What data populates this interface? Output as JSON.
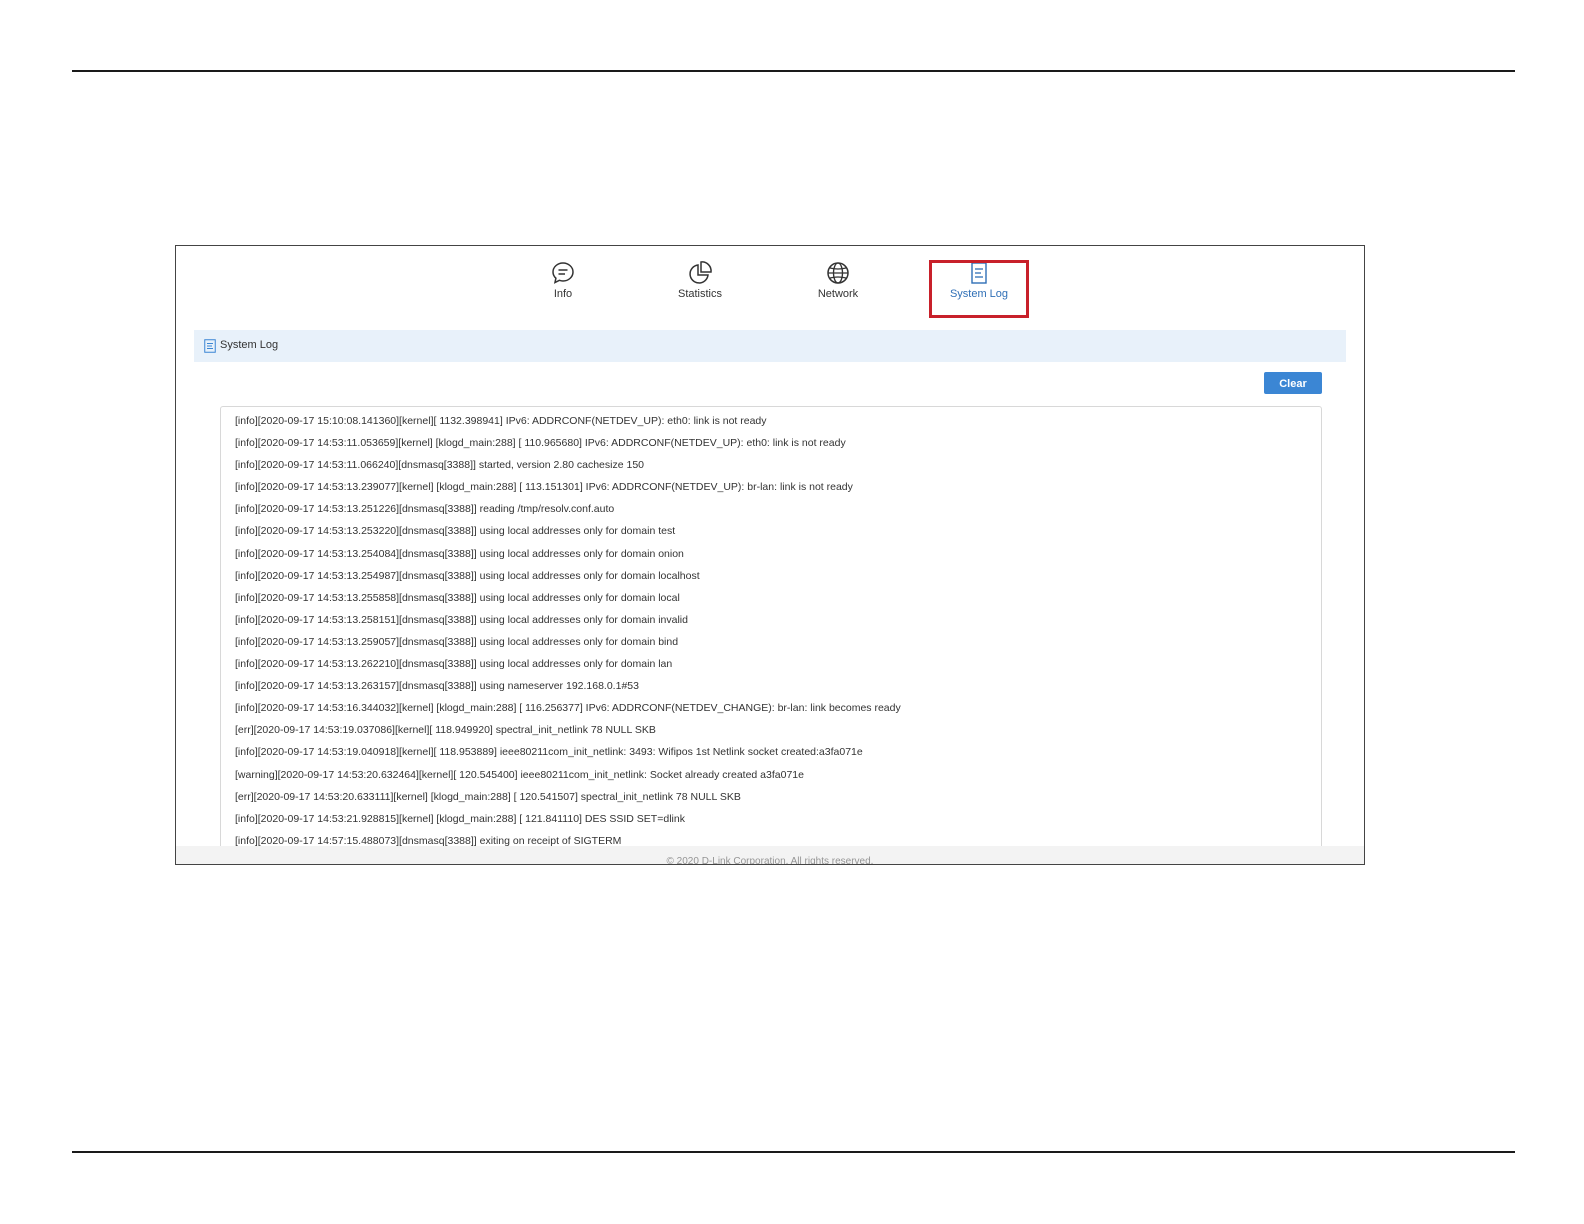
{
  "tabs": [
    {
      "label": "Info",
      "icon": "chat-bubble-icon"
    },
    {
      "label": "Statistics",
      "icon": "pie-chart-icon"
    },
    {
      "label": "Network",
      "icon": "globe-icon"
    },
    {
      "label": "System Log",
      "icon": "document-icon",
      "active": true
    }
  ],
  "section": {
    "title": "System Log",
    "icon": "document-icon"
  },
  "actions": {
    "clear_label": "Clear"
  },
  "log_lines": [
    "[info][2020-09-17 15:10:08.141360][kernel][ 1132.398941] IPv6: ADDRCONF(NETDEV_UP): eth0: link is not ready",
    "[info][2020-09-17 14:53:11.053659][kernel] [klogd_main:288] [  110.965680] IPv6: ADDRCONF(NETDEV_UP): eth0: link is not ready",
    "[info][2020-09-17 14:53:11.066240][dnsmasq[3388]] started, version 2.80 cachesize 150",
    "[info][2020-09-17 14:53:13.239077][kernel] [klogd_main:288] [  113.151301] IPv6: ADDRCONF(NETDEV_UP): br-lan: link is not ready",
    "[info][2020-09-17 14:53:13.251226][dnsmasq[3388]] reading /tmp/resolv.conf.auto",
    "[info][2020-09-17 14:53:13.253220][dnsmasq[3388]] using local addresses only for domain test",
    "[info][2020-09-17 14:53:13.254084][dnsmasq[3388]] using local addresses only for domain onion",
    "[info][2020-09-17 14:53:13.254987][dnsmasq[3388]] using local addresses only for domain localhost",
    "[info][2020-09-17 14:53:13.255858][dnsmasq[3388]] using local addresses only for domain local",
    "[info][2020-09-17 14:53:13.258151][dnsmasq[3388]] using local addresses only for domain invalid",
    "[info][2020-09-17 14:53:13.259057][dnsmasq[3388]] using local addresses only for domain bind",
    "[info][2020-09-17 14:53:13.262210][dnsmasq[3388]] using local addresses only for domain lan",
    "[info][2020-09-17 14:53:13.263157][dnsmasq[3388]] using nameserver 192.168.0.1#53",
    "[info][2020-09-17 14:53:16.344032][kernel] [klogd_main:288] [  116.256377] IPv6: ADDRCONF(NETDEV_CHANGE): br-lan: link becomes ready",
    "[err][2020-09-17 14:53:19.037086][kernel][  118.949920] spectral_init_netlink 78 NULL SKB",
    "[info][2020-09-17 14:53:19.040918][kernel][  118.953889] ieee80211com_init_netlink: 3493: Wifipos 1st Netlink socket created:a3fa071e",
    "[warning][2020-09-17 14:53:20.632464][kernel][  120.545400] ieee80211com_init_netlink: Socket already created a3fa071e",
    "[err][2020-09-17 14:53:20.633111][kernel] [klogd_main:288] [  120.541507] spectral_init_netlink 78 NULL SKB",
    "[info][2020-09-17 14:53:21.928815][kernel] [klogd_main:288] [  121.841110]  DES SSID SET=dlink",
    "[info][2020-09-17 14:57:15.488073][dnsmasq[3388]] exiting on receipt of SIGTERM"
  ],
  "footer": {
    "text": "© 2020 D-Link Corporation. All rights reserved."
  },
  "colors": {
    "accent": "#3b86d4",
    "highlight": "#c8202a",
    "section_bg": "#e8f1fa"
  }
}
